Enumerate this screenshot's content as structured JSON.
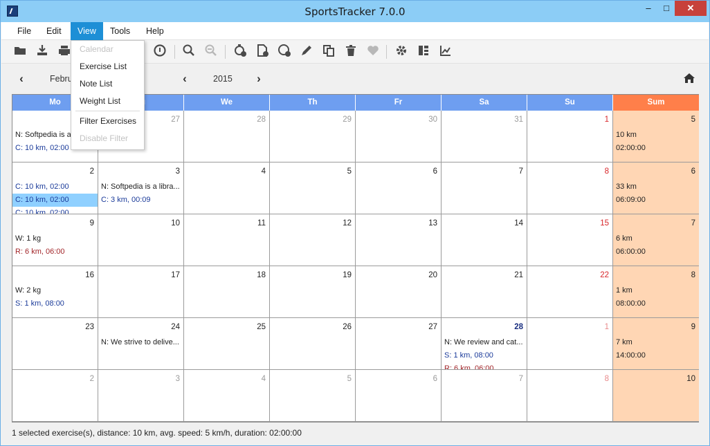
{
  "window": {
    "title": "SportsTracker 7.0.0"
  },
  "menubar": {
    "items": [
      "File",
      "Edit",
      "View",
      "Tools",
      "Help"
    ],
    "active": "View"
  },
  "toolbar": {
    "icons": [
      "open-folder-icon",
      "save-icon",
      "print-icon",
      "unknown-icon",
      "unknown-icon",
      "info-icon",
      "zoom-in-icon",
      "zoom-out-icon",
      "add-exercise-icon",
      "add-note-icon",
      "add-weight-icon",
      "edit-icon",
      "copy-icon",
      "delete-icon",
      "heart-rate-icon",
      "settings-icon",
      "overview-icon",
      "statistics-icon"
    ]
  },
  "view_menu": {
    "items": [
      {
        "label": "Calendar",
        "enabled": false
      },
      {
        "label": "Exercise List",
        "enabled": true
      },
      {
        "label": "Note List",
        "enabled": true
      },
      {
        "label": "Weight List",
        "enabled": true
      },
      {
        "label": "Filter Exercises",
        "enabled": true
      },
      {
        "label": "Disable Filter",
        "enabled": false
      }
    ]
  },
  "navbar": {
    "month": "Febru",
    "year": "2015"
  },
  "calendar": {
    "headers": [
      "Mo",
      "Tu",
      "We",
      "Th",
      "Fr",
      "Sa",
      "Su",
      "Sum"
    ],
    "weeks": [
      [
        {
          "day": "",
          "style": "",
          "entries": [
            {
              "text": "N: Softpedia is a",
              "color": "black"
            },
            {
              "text": "C: 10 km, 02:00",
              "color": "blue"
            }
          ]
        },
        {
          "day": "27",
          "style": "gray",
          "entries": []
        },
        {
          "day": "28",
          "style": "gray",
          "entries": []
        },
        {
          "day": "29",
          "style": "gray",
          "entries": []
        },
        {
          "day": "30",
          "style": "gray",
          "entries": []
        },
        {
          "day": "31",
          "style": "gray",
          "entries": []
        },
        {
          "day": "1",
          "style": "red",
          "entries": []
        },
        {
          "day": "5",
          "style": "",
          "sum": true,
          "entries": [
            {
              "text": "10 km",
              "color": "black"
            },
            {
              "text": "02:00:00",
              "color": "black"
            }
          ]
        }
      ],
      [
        {
          "day": "2",
          "style": "",
          "entries": [
            {
              "text": "C: 10 km, 02:00",
              "color": "blue"
            },
            {
              "text": "C: 10 km, 02:00",
              "color": "blue",
              "selected": true
            },
            {
              "text": "C: 10 km, 02:00",
              "color": "blue"
            }
          ]
        },
        {
          "day": "3",
          "style": "",
          "entries": [
            {
              "text": "N: Softpedia is a libra...",
              "color": "black"
            },
            {
              "text": "C: 3 km, 00:09",
              "color": "blue"
            }
          ]
        },
        {
          "day": "4",
          "style": "",
          "entries": []
        },
        {
          "day": "5",
          "style": "",
          "entries": []
        },
        {
          "day": "6",
          "style": "",
          "entries": []
        },
        {
          "day": "7",
          "style": "",
          "entries": []
        },
        {
          "day": "8",
          "style": "red",
          "entries": []
        },
        {
          "day": "6",
          "style": "",
          "sum": true,
          "entries": [
            {
              "text": "33 km",
              "color": "black"
            },
            {
              "text": "06:09:00",
              "color": "black"
            }
          ]
        }
      ],
      [
        {
          "day": "9",
          "style": "",
          "entries": [
            {
              "text": "W: 1 kg",
              "color": "black"
            },
            {
              "text": "R: 6 km, 06:00",
              "color": "red"
            }
          ]
        },
        {
          "day": "10",
          "style": "",
          "entries": []
        },
        {
          "day": "11",
          "style": "",
          "entries": []
        },
        {
          "day": "12",
          "style": "",
          "entries": []
        },
        {
          "day": "13",
          "style": "",
          "entries": []
        },
        {
          "day": "14",
          "style": "",
          "entries": []
        },
        {
          "day": "15",
          "style": "red",
          "entries": []
        },
        {
          "day": "7",
          "style": "",
          "sum": true,
          "entries": [
            {
              "text": "6 km",
              "color": "black"
            },
            {
              "text": "06:00:00",
              "color": "black"
            }
          ]
        }
      ],
      [
        {
          "day": "16",
          "style": "",
          "entries": [
            {
              "text": "W: 2 kg",
              "color": "black"
            },
            {
              "text": "S: 1 km, 08:00",
              "color": "blue"
            }
          ]
        },
        {
          "day": "17",
          "style": "",
          "entries": []
        },
        {
          "day": "18",
          "style": "",
          "entries": []
        },
        {
          "day": "19",
          "style": "",
          "entries": []
        },
        {
          "day": "20",
          "style": "",
          "entries": []
        },
        {
          "day": "21",
          "style": "",
          "entries": []
        },
        {
          "day": "22",
          "style": "red",
          "entries": []
        },
        {
          "day": "8",
          "style": "",
          "sum": true,
          "entries": [
            {
              "text": "1 km",
              "color": "black"
            },
            {
              "text": "08:00:00",
              "color": "black"
            }
          ]
        }
      ],
      [
        {
          "day": "23",
          "style": "",
          "entries": []
        },
        {
          "day": "24",
          "style": "",
          "entries": [
            {
              "text": "N: We strive to delive...",
              "color": "black"
            }
          ]
        },
        {
          "day": "25",
          "style": "",
          "entries": []
        },
        {
          "day": "26",
          "style": "",
          "entries": []
        },
        {
          "day": "27",
          "style": "",
          "entries": []
        },
        {
          "day": "28",
          "style": "bold",
          "entries": [
            {
              "text": "N: We review and cat...",
              "color": "black"
            },
            {
              "text": "S: 1 km, 08:00",
              "color": "blue"
            },
            {
              "text": "R: 6 km, 06:00",
              "color": "red"
            }
          ]
        },
        {
          "day": "1",
          "style": "redlight",
          "entries": []
        },
        {
          "day": "9",
          "style": "",
          "sum": true,
          "entries": [
            {
              "text": "7 km",
              "color": "black"
            },
            {
              "text": "14:00:00",
              "color": "black"
            }
          ]
        }
      ],
      [
        {
          "day": "2",
          "style": "gray",
          "entries": []
        },
        {
          "day": "3",
          "style": "gray",
          "entries": []
        },
        {
          "day": "4",
          "style": "gray",
          "entries": []
        },
        {
          "day": "5",
          "style": "gray",
          "entries": []
        },
        {
          "day": "6",
          "style": "gray",
          "entries": []
        },
        {
          "day": "7",
          "style": "gray",
          "entries": []
        },
        {
          "day": "8",
          "style": "redlight",
          "entries": []
        },
        {
          "day": "10",
          "style": "",
          "sum": true,
          "entries": []
        }
      ]
    ]
  },
  "status": {
    "text": "1 selected exercise(s), distance: 10 km, avg. speed: 5 km/h, duration: 02:00:00"
  }
}
